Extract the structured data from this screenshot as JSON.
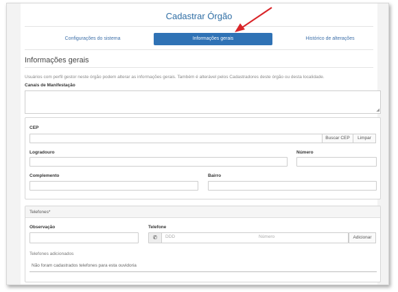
{
  "page": {
    "title": "Cadastrar Órgão"
  },
  "tabs": [
    {
      "label": "Configurações do sistema",
      "active": false
    },
    {
      "label": "Informações gerais",
      "active": true
    },
    {
      "label": "Histórico de alterações",
      "active": false
    }
  ],
  "section": {
    "title": "Informações gerais",
    "help": "Usuários com perfil gestor neste órgão podem alterar as informações gerais. Também é alterável pelos Cadastradores deste órgão ou desta localidade."
  },
  "canais": {
    "label": "Canais de Manifestação",
    "value": ""
  },
  "address": {
    "cep_label": "CEP",
    "cep_value": "",
    "buscar_label": "Buscar CEP",
    "limpar_label": "Limpar",
    "logradouro_label": "Logradouro",
    "numero_label": "Número",
    "complemento_label": "Complemento",
    "bairro_label": "Bairro"
  },
  "telefones": {
    "header": "Telefones*",
    "observacao_label": "Observação",
    "telefone_label": "Telefone",
    "ddd_placeholder": "DDD",
    "numero_placeholder": "Número",
    "adicionar_label": "Adicionar",
    "added_label": "Telefones adicionados",
    "empty_message": "Não foram cadastrados telefones para esta ouvidoria"
  },
  "icons": {
    "phone": "phone-icon"
  },
  "colors": {
    "accent": "#2f72b5",
    "arrow": "#d9262a"
  }
}
